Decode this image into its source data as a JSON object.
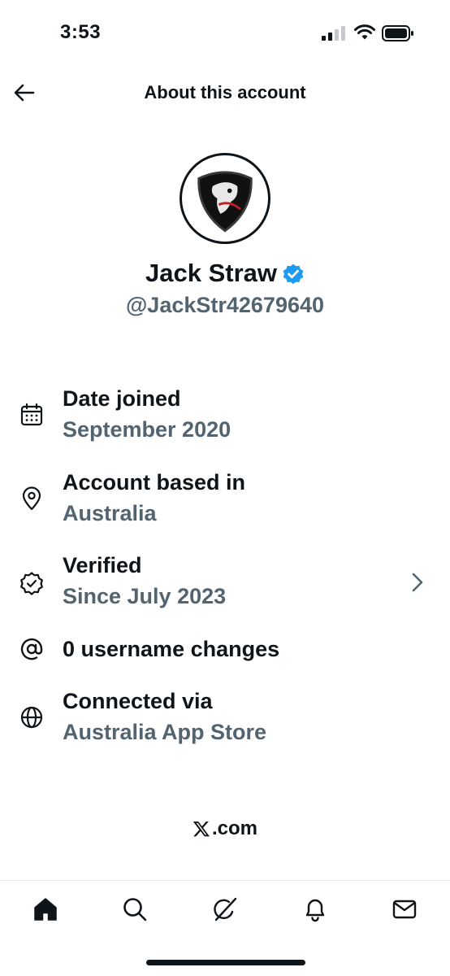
{
  "status_bar": {
    "time": "3:53",
    "icons": [
      "cellular-signal-icon",
      "wifi-icon",
      "battery-icon"
    ]
  },
  "header": {
    "title": "About this account",
    "back_icon": "arrow-left-icon"
  },
  "profile": {
    "display_name": "Jack Straw",
    "handle": "@JackStr42679640",
    "verified": true,
    "verified_color": "#1d9bf0"
  },
  "info": [
    {
      "icon": "calendar-icon",
      "label": "Date joined",
      "value": "September 2020"
    },
    {
      "icon": "location-pin-icon",
      "label": "Account based in",
      "value": "Australia"
    },
    {
      "icon": "verified-check-icon",
      "label": "Verified",
      "value": "Since July 2023",
      "has_chevron": true
    },
    {
      "icon": "at-sign-icon",
      "label": "0 username changes"
    },
    {
      "icon": "globe-icon",
      "label": "Connected via",
      "value": "Australia App Store"
    }
  ],
  "footer": {
    "link_text": ".com"
  },
  "tabs": [
    "home-icon",
    "search-icon",
    "grok-icon",
    "notifications-icon",
    "messages-icon"
  ],
  "colors": {
    "text_primary": "#0f1419",
    "text_secondary": "#536471",
    "accent": "#1d9bf0"
  }
}
